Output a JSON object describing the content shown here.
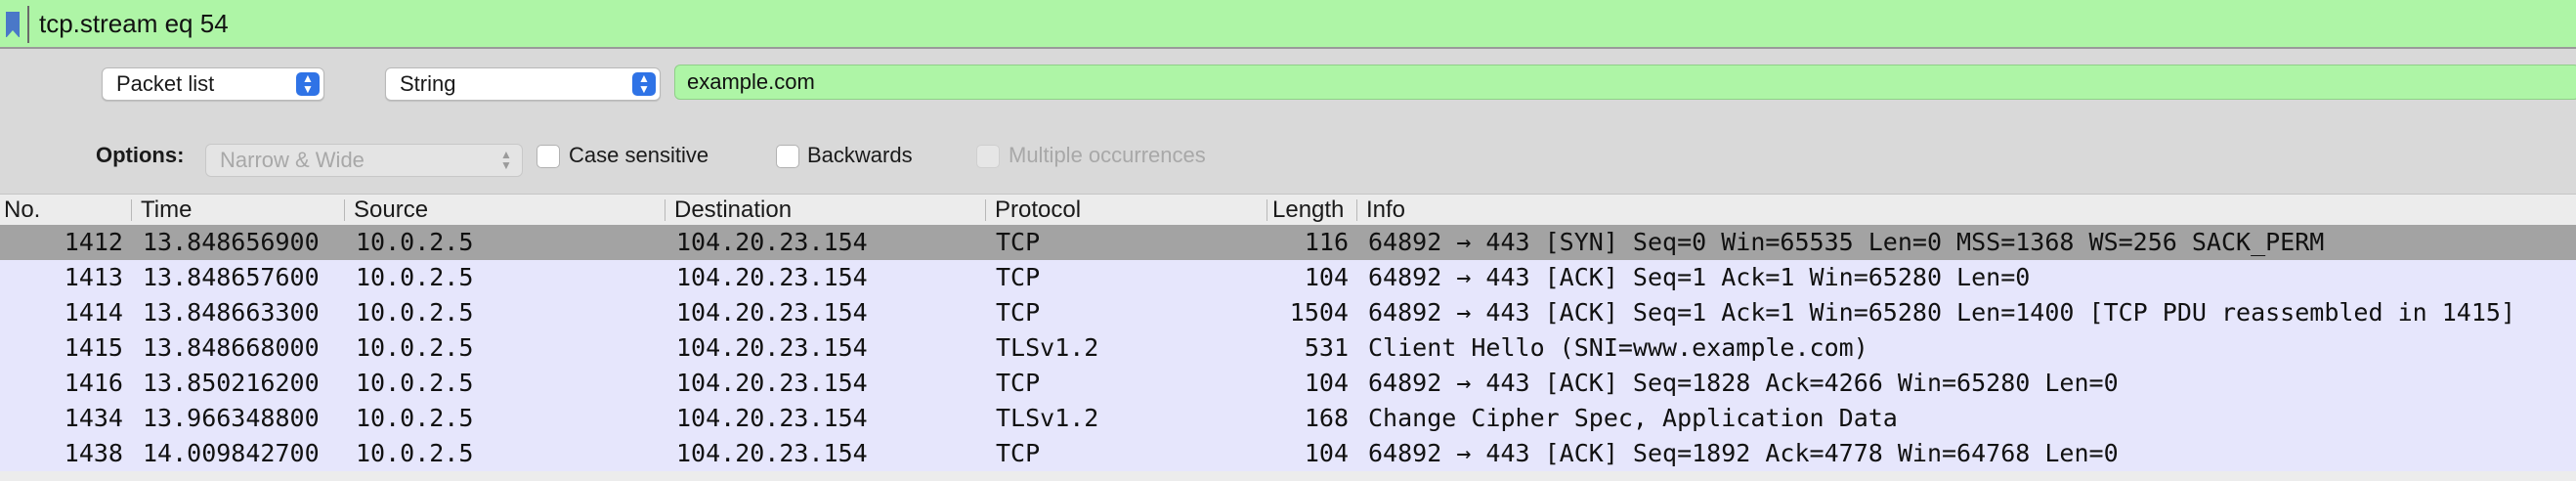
{
  "filter": {
    "text": "tcp.stream eq 54"
  },
  "find": {
    "search_in": "Packet list",
    "search_type": "String",
    "query": "example.com",
    "options_label": "Options:",
    "charset": "Narrow & Wide",
    "case_sensitive": "Case sensitive",
    "backwards": "Backwards",
    "multiple": "Multiple occurrences"
  },
  "columns": {
    "no": "No.",
    "time": "Time",
    "source": "Source",
    "destination": "Destination",
    "protocol": "Protocol",
    "length": "Length",
    "info": "Info"
  },
  "packets": [
    {
      "no": "1412",
      "time": "13.848656900",
      "src": "10.0.2.5",
      "dst": "104.20.23.154",
      "proto": "TCP",
      "len": "116",
      "info": "64892 → 443 [SYN] Seq=0 Win=65535 Len=0 MSS=1368 WS=256 SACK_PERM"
    },
    {
      "no": "1413",
      "time": "13.848657600",
      "src": "10.0.2.5",
      "dst": "104.20.23.154",
      "proto": "TCP",
      "len": "104",
      "info": "64892 → 443 [ACK] Seq=1 Ack=1 Win=65280 Len=0"
    },
    {
      "no": "1414",
      "time": "13.848663300",
      "src": "10.0.2.5",
      "dst": "104.20.23.154",
      "proto": "TCP",
      "len": "1504",
      "info": "64892 → 443 [ACK] Seq=1 Ack=1 Win=65280 Len=1400 [TCP PDU reassembled in 1415]"
    },
    {
      "no": "1415",
      "time": "13.848668000",
      "src": "10.0.2.5",
      "dst": "104.20.23.154",
      "proto": "TLSv1.2",
      "len": "531",
      "info": "Client Hello (SNI=www.example.com)"
    },
    {
      "no": "1416",
      "time": "13.850216200",
      "src": "10.0.2.5",
      "dst": "104.20.23.154",
      "proto": "TCP",
      "len": "104",
      "info": "64892 → 443 [ACK] Seq=1828 Ack=4266 Win=65280 Len=0"
    },
    {
      "no": "1434",
      "time": "13.966348800",
      "src": "10.0.2.5",
      "dst": "104.20.23.154",
      "proto": "TLSv1.2",
      "len": "168",
      "info": "Change Cipher Spec, Application Data"
    },
    {
      "no": "1438",
      "time": "14.009842700",
      "src": "10.0.2.5",
      "dst": "104.20.23.154",
      "proto": "TCP",
      "len": "104",
      "info": "64892 → 443 [ACK] Seq=1892 Ack=4778 Win=64768 Len=0"
    }
  ]
}
